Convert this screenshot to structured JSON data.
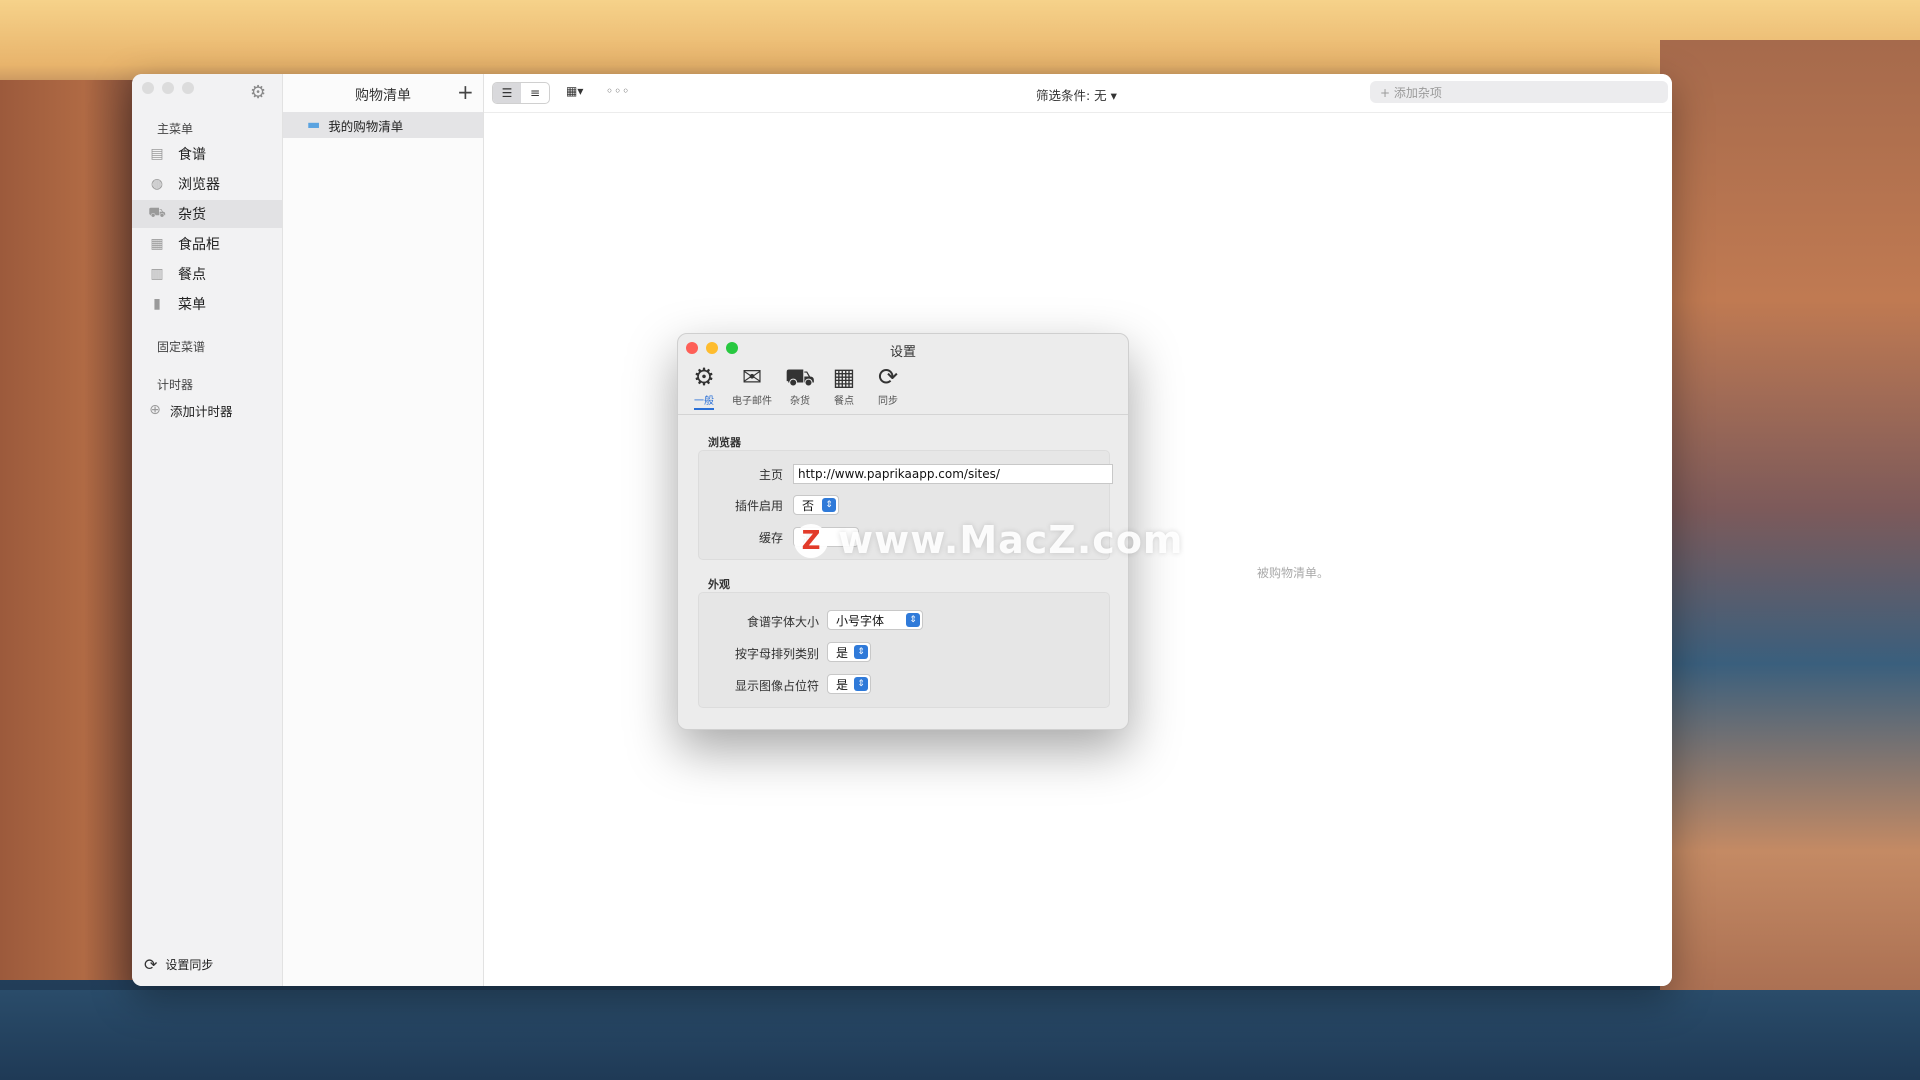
{
  "sidebar": {
    "main_section": "主菜单",
    "items": [
      {
        "label": "食谱",
        "icon": "recipe-box-icon",
        "glyph": "▤"
      },
      {
        "label": "浏览器",
        "icon": "globe-icon",
        "glyph": "◍"
      },
      {
        "label": "杂货",
        "icon": "cart-icon",
        "glyph": "⛟"
      },
      {
        "label": "食品柜",
        "icon": "pantry-icon",
        "glyph": "▦"
      },
      {
        "label": "餐点",
        "icon": "calendar-icon",
        "glyph": "▥"
      },
      {
        "label": "菜单",
        "icon": "menu-book-icon",
        "glyph": "▮"
      }
    ],
    "pinned_section": "固定菜谱",
    "timer_section": "计时器",
    "add_timer": "添加计时器",
    "sync": "设置同步"
  },
  "list_pane": {
    "title": "购物清单",
    "add_glyph": "+",
    "rows": [
      {
        "label": "我的购物清单"
      }
    ]
  },
  "toolbar": {
    "filter": "筛选条件: 无 ▾",
    "search_placeholder": "+ 添加杂项",
    "more_glyph": "◦◦◦",
    "grid_glyph": "▦▾"
  },
  "content": {
    "empty_text_partial": "被购物清单。"
  },
  "settings": {
    "title": "设置",
    "tabs": [
      {
        "label": "一般",
        "icon": "gear-icon",
        "glyph": "⚙"
      },
      {
        "label": "电子邮件",
        "icon": "envelope-icon",
        "glyph": "✉"
      },
      {
        "label": "杂货",
        "icon": "cart-icon",
        "glyph": "⛟"
      },
      {
        "label": "餐点",
        "icon": "calendar-icon",
        "glyph": "▦"
      },
      {
        "label": "同步",
        "icon": "sync-icon",
        "glyph": "⟳"
      }
    ],
    "browser_group": "浏览器",
    "homepage_label": "主页",
    "homepage_value": "http://www.paprikaapp.com/sites/",
    "plugins_label": "插件启用",
    "plugins_value": "否",
    "cache_label": "缓存",
    "cache_button": "清",
    "appearance_group": "外观",
    "font_size_label": "食谱字体大小",
    "font_size_value": "小号字体",
    "sort_label": "按字母排列类别",
    "sort_value": "是",
    "placeholder_label": "显示图像占位符",
    "placeholder_value": "是"
  },
  "watermark": {
    "logo_letter": "Z",
    "text": "www.MacZ.com"
  },
  "colors": {
    "accent": "#2f7ad9",
    "close": "#fe5f57",
    "minimize": "#febc2e",
    "zoom": "#28c840",
    "watermark_red": "#e23b2a"
  }
}
